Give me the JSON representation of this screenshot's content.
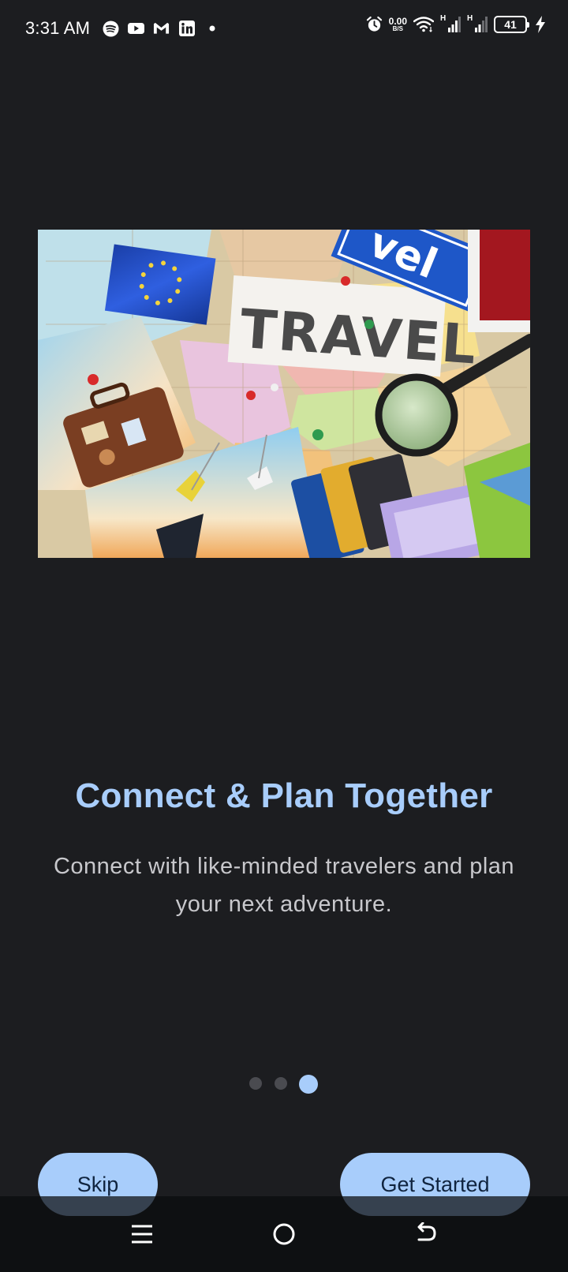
{
  "status_bar": {
    "time": "3:31 AM",
    "net_speed_value": "0.00",
    "net_speed_unit": "B/S",
    "signal_1_type": "H",
    "signal_2_type": "H",
    "battery_level": "41",
    "left_icons": [
      "spotify-icon",
      "youtube-icon",
      "gmail-icon",
      "linkedin-icon",
      "dot-icon"
    ],
    "right_icons": [
      "alarm-icon",
      "wifi-icon",
      "signal-icon",
      "signal-icon",
      "battery-icon",
      "charging-icon"
    ]
  },
  "hero": {
    "image": "travel-collage-map-image",
    "sign_text": "TRAVEL",
    "blue_sign_text": "vel"
  },
  "onboarding": {
    "title": "Connect & Plan Together",
    "subtitle": "Connect with like-minded travelers and plan your next adventure.",
    "page_count": 3,
    "active_page": 3
  },
  "actions": {
    "skip_label": "Skip",
    "get_started_label": "Get Started"
  },
  "nav_bar": {
    "icons": [
      "menu-icon",
      "home-icon",
      "back-icon"
    ]
  },
  "colors": {
    "background": "#1c1d20",
    "accent": "#a8cdfb",
    "button_text": "#10243f",
    "subtitle_text": "#c8c8cc",
    "inactive_dot": "#4a4b50"
  }
}
